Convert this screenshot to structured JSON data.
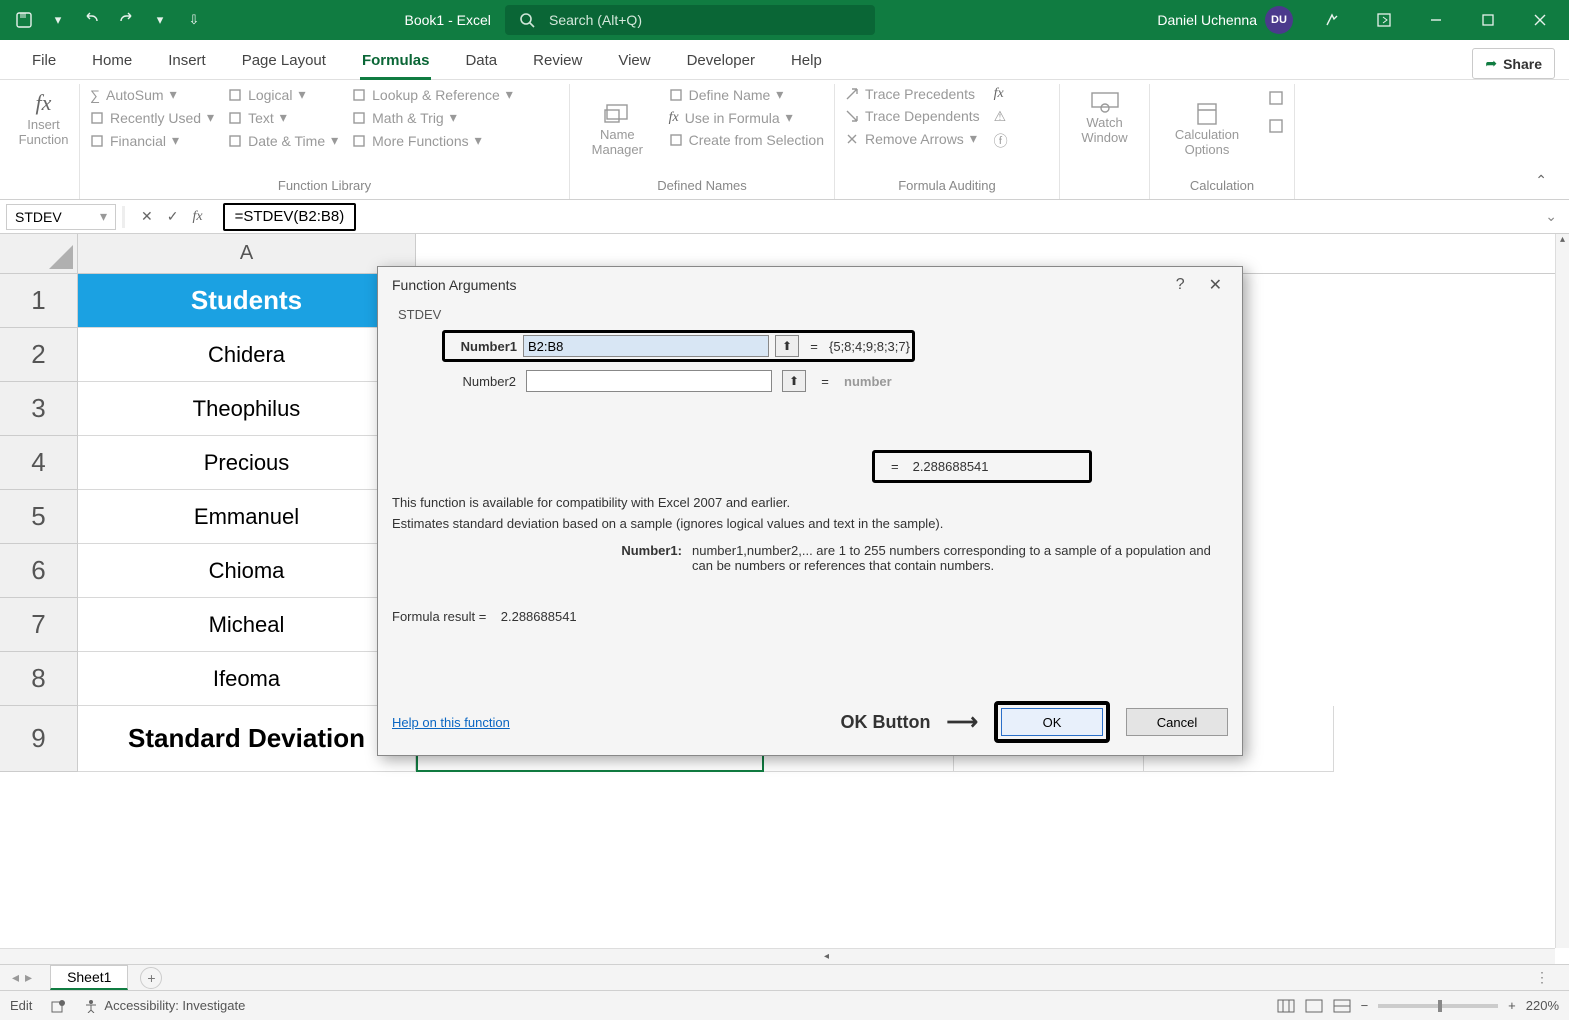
{
  "titlebar": {
    "doc_title": "Book1 - Excel",
    "search_placeholder": "Search (Alt+Q)",
    "user_name": "Daniel Uchenna",
    "user_initials": "DU"
  },
  "tabs": {
    "file": "File",
    "home": "Home",
    "insert": "Insert",
    "page_layout": "Page Layout",
    "formulas": "Formulas",
    "data": "Data",
    "review": "Review",
    "view": "View",
    "developer": "Developer",
    "help": "Help",
    "share": "Share"
  },
  "ribbon": {
    "insert_function": "Insert\nFunction",
    "autosum": "AutoSum",
    "recently_used": "Recently Used",
    "financial": "Financial",
    "logical": "Logical",
    "text": "Text",
    "date_time": "Date & Time",
    "lookup": "Lookup & Reference",
    "math_trig": "Math & Trig",
    "more": "More Functions",
    "name_manager": "Name\nManager",
    "define_name": "Define Name",
    "use_in_formula": "Use in Formula",
    "create_sel": "Create from Selection",
    "trace_prec": "Trace Precedents",
    "trace_dep": "Trace Dependents",
    "remove_arrows": "Remove Arrows",
    "watch_window": "Watch\nWindow",
    "calc_options": "Calculation\nOptions",
    "grp_lib": "Function Library",
    "grp_names": "Defined Names",
    "grp_audit": "Formula Auditing",
    "grp_calc": "Calculation"
  },
  "formulabar": {
    "namebox": "STDEV",
    "formula": "=STDEV(B2:B8)"
  },
  "columns": {
    "A": "A"
  },
  "rows": {
    "r1": "1",
    "r2": "2",
    "r3": "3",
    "r4": "4",
    "r5": "5",
    "r6": "6",
    "r7": "7",
    "r8": "8",
    "r9": "9"
  },
  "cells": {
    "A1": "Students",
    "A2": "Chidera",
    "A3": "Theophilus",
    "A4": "Precious",
    "A5": "Emmanuel",
    "A6": "Chioma",
    "A7": "Micheal",
    "A8": "Ifeoma",
    "A9": "Standard Deviation",
    "B9": "=STDEV(B2:B8)"
  },
  "dialog": {
    "title": "Function Arguments",
    "func": "STDEV",
    "arg1_label": "Number1",
    "arg1_value": "B2:B8",
    "arg1_result": "{5;8;4;9;8;3;7}",
    "arg2_label": "Number2",
    "arg2_value": "",
    "arg2_result": "number",
    "result_eq": "=",
    "result_val": "2.288688541",
    "desc1": "This function is available for compatibility with Excel 2007 and earlier.",
    "desc2": "Estimates standard deviation based on a sample (ignores logical values and text in the sample).",
    "argname": "Number1:",
    "argdesc": "number1,number2,... are 1 to 255 numbers corresponding to a sample of a population and can be numbers or references that contain numbers.",
    "formula_result_label": "Formula result =",
    "formula_result_val": "2.288688541",
    "help_link": "Help on this function",
    "ok_annot": "OK Button",
    "ok": "OK",
    "cancel": "Cancel"
  },
  "sheet_tabs": {
    "sheet1": "Sheet1"
  },
  "statusbar": {
    "mode": "Edit",
    "acc": "Accessibility: Investigate",
    "zoom": "220%"
  }
}
